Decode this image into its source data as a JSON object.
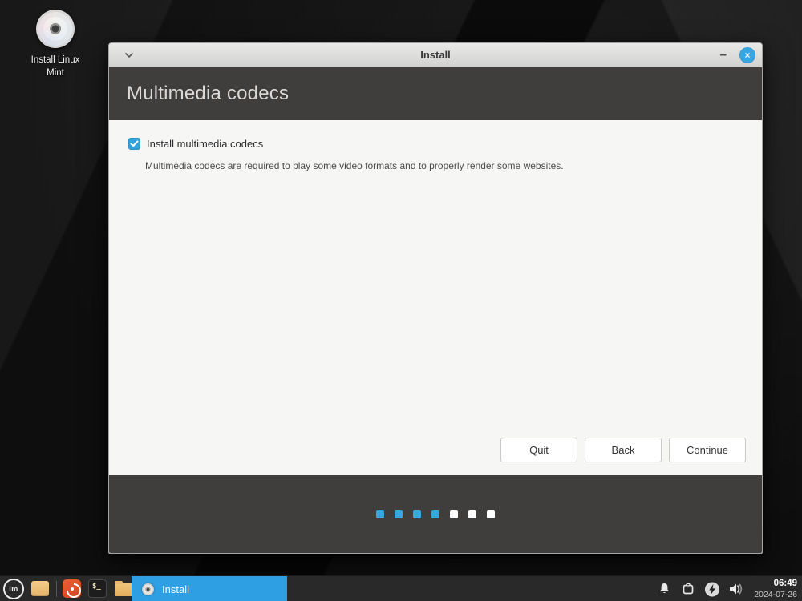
{
  "desktop": {
    "icon": {
      "label_line1": "Install Linux",
      "label_line2": "Mint"
    }
  },
  "installer": {
    "titlebar": {
      "title": "Install",
      "minimize_glyph": "–",
      "close_glyph": "×"
    },
    "header_title": "Multimedia codecs",
    "checkbox": {
      "label": "Install multimedia codecs",
      "checked": true
    },
    "description": "Multimedia codecs are required to play some video formats and to properly render some websites.",
    "buttons": [
      {
        "id": "quit",
        "label": "Quit"
      },
      {
        "id": "back",
        "label": "Back"
      },
      {
        "id": "continue",
        "label": "Continue"
      }
    ],
    "progress": {
      "total_steps": 7,
      "completed_steps": 4,
      "active_color": "#35a9db",
      "inactive_color": "#ffffff"
    }
  },
  "taskbar": {
    "menu_monogram": "lm",
    "terminal_glyph": "$_",
    "task_button": {
      "label": "Install"
    },
    "clock": {
      "time": "06:49",
      "date": "2024-07-26"
    }
  },
  "colors": {
    "accent_blue": "#35a9db",
    "header_dark": "#403e3d",
    "content_bg": "#f6f6f5",
    "taskbar_bg": "#292929",
    "task_button_blue": "#2f9fe3"
  }
}
